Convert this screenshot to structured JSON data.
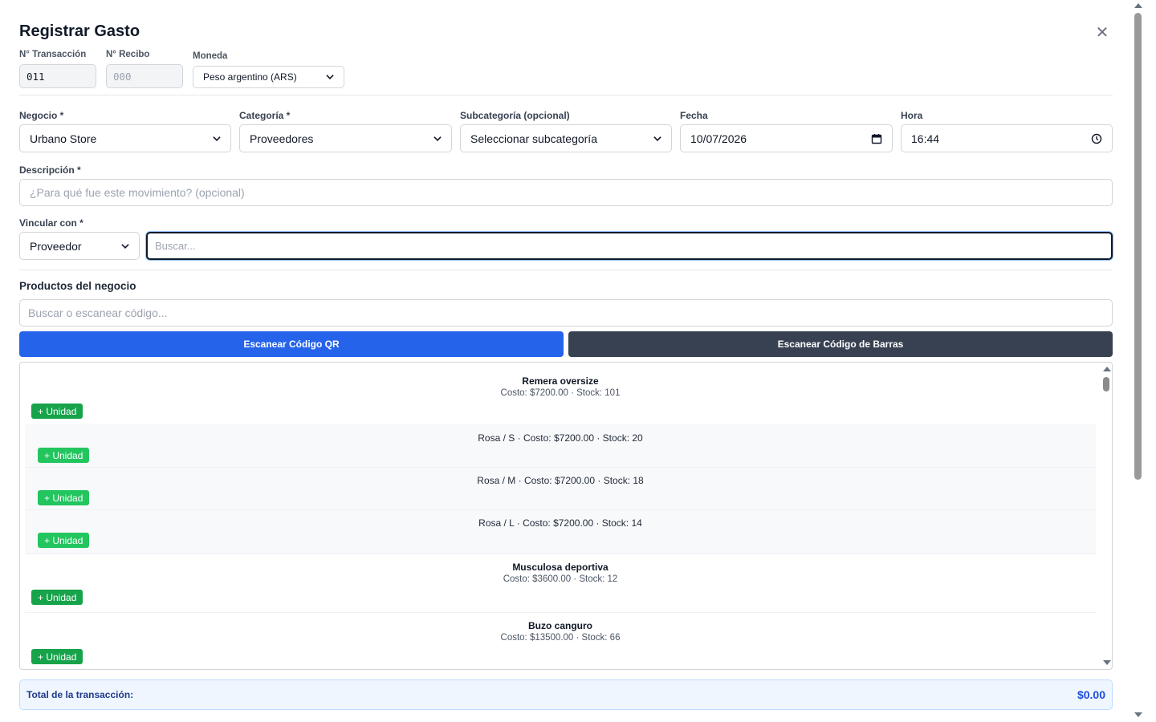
{
  "modal": {
    "title": "Registrar Gasto",
    "close_icon": "close-icon"
  },
  "header": {
    "transaction_label": "N° Transacción",
    "transaction_value": "011",
    "receipt_label": "N° Recibo",
    "receipt_placeholder": "000",
    "currency_label": "Moneda",
    "currency_value": "Peso argentino (ARS)"
  },
  "form": {
    "business_label": "Negocio *",
    "business_value": "Urbano Store",
    "category_label": "Categoría *",
    "category_value": "Proveedores",
    "subcategory_label": "Subcategoría (opcional)",
    "subcategory_value": "Seleccionar subcategoría",
    "date_label": "Fecha",
    "date_value": "10/07/2026",
    "time_label": "Hora",
    "time_value": "16:44",
    "description_label": "Descripción *",
    "description_placeholder": "¿Para qué fue este movimiento? (opcional)",
    "link_label": "Vincular con *",
    "link_type_value": "Proveedor",
    "link_search_placeholder": "Buscar..."
  },
  "products": {
    "section_title": "Productos del negocio",
    "search_placeholder": "Buscar o escanear código...",
    "scan_qr_label": "Escanear Código QR",
    "scan_barcode_label": "Escanear Código de Barras",
    "add_label": "+ Unidad",
    "items": [
      {
        "name": "Remera oversize",
        "info": "Costo: $7200.00 · Stock: 101"
      },
      {
        "variant": "Rosa / S · Costo: $7200.00 · Stock: 20"
      },
      {
        "variant": "Rosa / M · Costo: $7200.00 · Stock: 18"
      },
      {
        "variant": "Rosa / L · Costo: $7200.00 · Stock: 14"
      },
      {
        "name": "Musculosa deportiva",
        "info": "Costo: $3600.00 · Stock: 12"
      },
      {
        "name": "Buzo canguro",
        "info": "Costo: $13500.00 · Stock: 66"
      }
    ]
  },
  "total": {
    "label": "Total de la transacción:",
    "value": "$0.00"
  },
  "colors": {
    "primary": "#2563eb",
    "dark": "#374151",
    "success": "#16a34a",
    "success_light": "#22c55e"
  }
}
